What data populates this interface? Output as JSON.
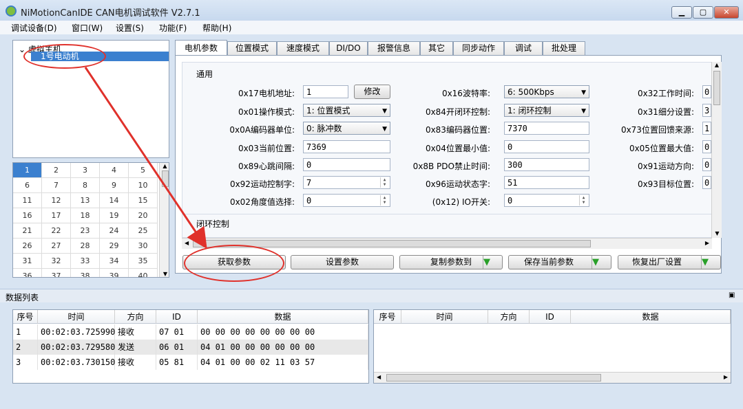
{
  "window": {
    "title": "NiMotionCanIDE CAN电机调试软件 V2.7.1",
    "minimize": "▁",
    "maximize": "▢",
    "close": "✕"
  },
  "menu": [
    "调试设备(D)",
    "窗口(W)",
    "设置(S)",
    "功能(F)",
    "帮助(H)"
  ],
  "tree": {
    "root": "虚拟主机",
    "child": "1号电动机"
  },
  "node_grid": [
    "1",
    "2",
    "3",
    "4",
    "5",
    "6",
    "7",
    "8",
    "9",
    "10",
    "11",
    "12",
    "13",
    "14",
    "15",
    "16",
    "17",
    "18",
    "19",
    "20",
    "21",
    "22",
    "23",
    "24",
    "25",
    "26",
    "27",
    "28",
    "29",
    "30",
    "31",
    "32",
    "33",
    "34",
    "35",
    "36",
    "37",
    "38",
    "39",
    "40"
  ],
  "tabs": [
    "电机参数",
    "位置模式",
    "速度模式",
    "DI/DO",
    "报警信息",
    "其它",
    "同步动作",
    "调试",
    "批处理"
  ],
  "groups": {
    "general": "通用",
    "closed_loop": "闭环控制"
  },
  "params": {
    "c1": [
      {
        "label": "0x17电机地址:",
        "value": "1",
        "button": "修改"
      },
      {
        "label": "0x01操作模式:",
        "value": "1: 位置模式"
      },
      {
        "label": "0x0A编码器单位:",
        "value": "0: 脉冲数"
      },
      {
        "label": "0x03当前位置:",
        "value": "7369"
      },
      {
        "label": "0x89心跳间隔:",
        "value": "0"
      },
      {
        "label": "0x92运动控制字:",
        "value": "7"
      },
      {
        "label": "0x02角度值选择:",
        "value": "0"
      }
    ],
    "c2": [
      {
        "label": "0x16波特率:",
        "value": "6: 500Kbps"
      },
      {
        "label": "0x84开闭环控制:",
        "value": "1: 闭环控制"
      },
      {
        "label": "0x83编码器位置:",
        "value": "7370"
      },
      {
        "label": "0x04位置最小值:",
        "value": "0"
      },
      {
        "label": "0x8B PDO禁止时间:",
        "value": "300"
      },
      {
        "label": "0x96运动状态字:",
        "value": "51"
      },
      {
        "label": "(0x12) IO开关:",
        "value": "0"
      }
    ],
    "c3": [
      {
        "label": "0x32工作时间:",
        "value": "0"
      },
      {
        "label": "0x31细分设置:",
        "value": "3"
      },
      {
        "label": "0x73位置回馈来源:",
        "value": "1"
      },
      {
        "label": "0x05位置最大值:",
        "value": "0"
      },
      {
        "label": "0x91运动方向:",
        "value": "0"
      },
      {
        "label": "0x93目标位置:",
        "value": "0"
      }
    ]
  },
  "actions": {
    "get": "获取参数",
    "set": "设置参数",
    "copy": "复制参数到",
    "save": "保存当前参数",
    "restore": "恢复出厂设置",
    "dropdown": "▼"
  },
  "data_list": {
    "title": "数据列表",
    "columns": [
      "序号",
      "时间",
      "方向",
      "ID",
      "数据"
    ],
    "rows": [
      {
        "no": "1",
        "time": "00:02:03.725990",
        "dir": "接收",
        "id": "07 01",
        "data": "00 00 00 00 00 00 00 00"
      },
      {
        "no": "2",
        "time": "00:02:03.729580",
        "dir": "发送",
        "id": "06 01",
        "data": "04 01 00 00 00 00 00 00"
      },
      {
        "no": "3",
        "time": "00:02:03.730150",
        "dir": "接收",
        "id": "05 81",
        "data": "04 01 00 00 02 11 03 57"
      }
    ]
  },
  "colors": {
    "selection": "#3b80cf",
    "annotation": "#e0312b",
    "accent_green": "#2aa02a"
  }
}
